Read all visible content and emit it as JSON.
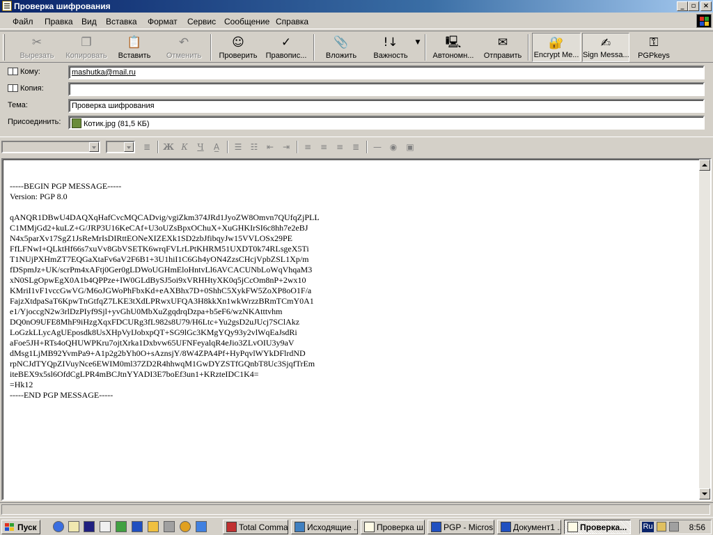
{
  "window": {
    "title": "Проверка шифрования"
  },
  "menu": [
    "Файл",
    "Правка",
    "Вид",
    "Вставка",
    "Формат",
    "Сервис",
    "Сообщение",
    "Справка"
  ],
  "toolbar": {
    "cut": "Вырезать",
    "copy": "Копировать",
    "paste": "Вставить",
    "undo": "Отменить",
    "check": "Проверить",
    "spelling": "Правопис...",
    "attach": "Вложить",
    "priority": "Важность",
    "offline": "Автономн...",
    "send": "Отправить",
    "encrypt": "Encrypt Me...",
    "sign": "Sign Messa...",
    "pgpkeys": "PGPkeys"
  },
  "header": {
    "to_label": "Кому:",
    "to_value": "mashutka@mail.ru",
    "cc_label": "Копия:",
    "cc_value": "",
    "subject_label": "Тема:",
    "subject_value": "Проверка шифрования",
    "attach_label": "Присоединить:",
    "attach_value": "Котик.jpg (81,5 КБ)"
  },
  "format": {
    "bold": "Ж",
    "italic": "К",
    "underline": "Ч"
  },
  "message": {
    "body": "-----BEGIN PGP MESSAGE-----\nVersion: PGP 8.0\n\nqANQR1DBwU4DAQXqHafCvcMQCADvig/vgiZkm374JRd1JyoZW8Omvn7QUfqZjPLL\nC1MMjGd2+kuLZ+G/JRP3U16KeCAf+U3oUZsBpxOChuX+XuGHKIrSI6c8hh7e2eBJ\nN4x5parXv17SgZ1JsReMrIsDIRttEONeXIZEXk1SD2zbJfibqyJw15VVLOSx29PE\nFfLFNwI+QLktHf66s7xuVv8GbVSETK6wrqFVLrLPtKHRM51UXDT0k74RLsgeX5Ti\nT1NUjPXHmZT7EQGaXtaFv6aV2F6B1+3U1hiI1C6Gh4yON4ZzsCHcjVpbZSL1Xp/m\nfDSpmJz+UK/scrPm4xAFtj0Ger0gLDWoUGHmEloHntvLl6AVCACUNbLoWqVhqaM3\nxN0SLgOpwEgX0A1b4QPPze+IW0GLdBySJ5oi9xVRHHtyXK0q5jCcOm8nP+2wx10\nKMriI1vF1vccGwVG/M6oJGWoPhFbxKd+eAXBhx7D+0ShhC5XykFW5ZoXP8oO1F/a\nFajzXtdpaSaT6KpwTnGtfqZ7LKE3tXdLPRwxUFQA3H8kkXn1wkWrzzBRmTCmY0A1\ne1/YjoccgN2w3rlDzPIyf9Sjl+yvGhU0MbXuZgqdrqDzpa+b5eF6/wzNKAtttvhm\nDQ0nO9UFE8MhF9iHzgXqxFDCURg3fL982s8U79/H6Ltc+Yu2gsD2uJUcj7SClAkz\nLoGzkLLycAgUEposdk8UsXHpVyIJobxpQT+SG9lGc3KMgYQy93y2vlWqEaJsdRi\naFoe5JH+RTs4oQHUWPKru7ojtXrka1Dxbvw65UFNFeyalqR4eJio3ZLvOIU3y9aV\ndMsg1LjMB92YvmPa9+A1p2g2bYh0O+sAznsjY/8W4ZPA4Pf+HyPqvlWYkDFlrdND\nrpNCJdTYQpZIVuyNce6EWIM0ml37ZD2R4hhwqM1GwDYZSTfGQnbT8Uc3SjqfTrEm\niteBEX9x5sl6OfdCgLPR4mBCJtnYYADI3E7boEf3un1+KRzteIDC1K4=\n=Hk12\n-----END PGP MESSAGE-----"
  },
  "taskbar": {
    "start": "Пуск",
    "tasks": [
      "Total Comma...",
      "Исходящие ...",
      "Проверка ш...",
      "PGP - Micros...",
      "Документ1 ...",
      "Проверка..."
    ],
    "lang": "Ru",
    "clock": "8:56"
  }
}
